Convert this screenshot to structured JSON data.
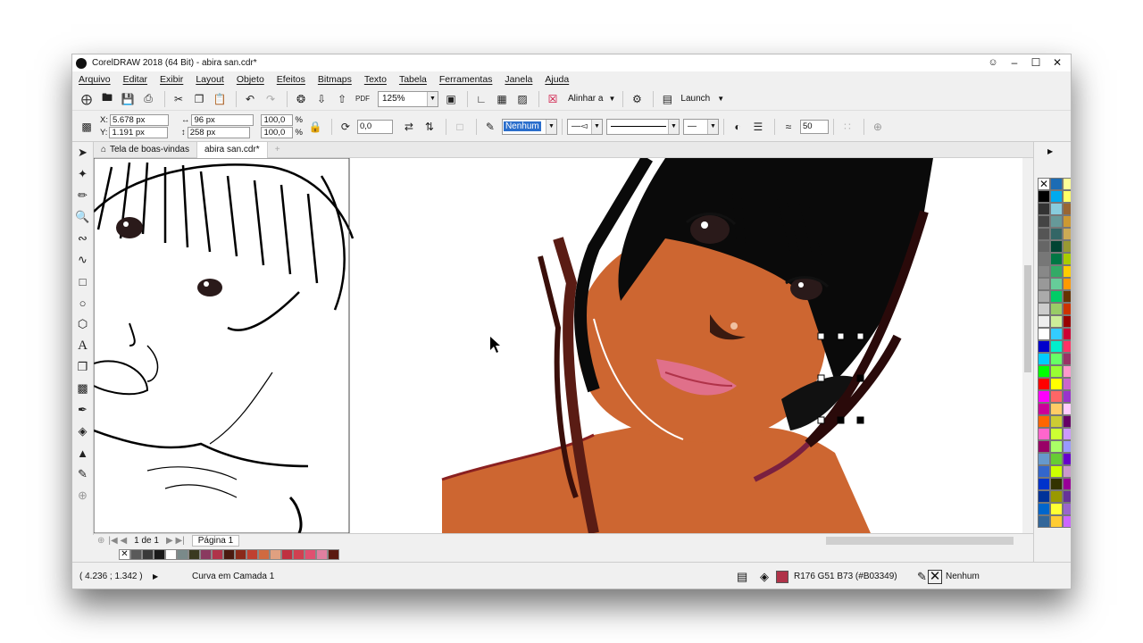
{
  "window": {
    "title": "CorelDRAW 2018 (64 Bit) - abira san.cdr*",
    "controls": [
      "–",
      "☐",
      "✕"
    ]
  },
  "menu": [
    "Arquivo",
    "Editar",
    "Exibir",
    "Layout",
    "Objeto",
    "Efeitos",
    "Bitmaps",
    "Texto",
    "Tabela",
    "Ferramentas",
    "Janela",
    "Ajuda"
  ],
  "toolbar": {
    "zoom": "125%",
    "align_label": "Alinhar a",
    "launch_label": "Launch"
  },
  "properties": {
    "x_label": "X:",
    "x_value": "5.678 px",
    "y_label": "Y:",
    "y_value": "1.191 px",
    "w_value": "96 px",
    "h_value": "258 px",
    "scale_w": "100,0",
    "scale_h": "100,0",
    "pct": "%",
    "rotation": "0,0",
    "outline_value": "Nenhum",
    "smoothing": "50"
  },
  "tabs": {
    "welcome": "Tela de boas-vindas",
    "document": "abira san.cdr*"
  },
  "page_nav": {
    "counter": "1 de 1",
    "page_tab": "Página 1"
  },
  "status": {
    "coords": "( 4.236 ; 1.342 )",
    "object_info": "Curva em Camada 1",
    "fill_info": "R176 G51 B73 (#B03349)",
    "outline_info": "Nenhum",
    "fill_color": "#B03349"
  },
  "colors": {
    "skin": "#CD6631",
    "hair": "#0a0a0a",
    "lips": "#E0708A",
    "strand": "#5a1c14"
  },
  "palette_colors": [
    [
      "#000000",
      "#1c6cb4",
      "#ffff99"
    ],
    [
      "#222222",
      "#00aaee",
      "#ffff66"
    ],
    [
      "#333333",
      "#88ccdd",
      "#996633"
    ],
    [
      "#444444",
      "#669999",
      "#cc9933"
    ],
    [
      "#555555",
      "#336666",
      "#ccaa55"
    ],
    [
      "#666666",
      "#004433",
      "#999933"
    ],
    [
      "#777777",
      "#007744",
      "#aacc00"
    ],
    [
      "#888888",
      "#33aa66",
      "#ffcc00"
    ],
    [
      "#999999",
      "#66cc99",
      "#ff9900"
    ],
    [
      "#aaaaaa",
      "#00cc66",
      "#663300"
    ],
    [
      "#cccccc",
      "#99cc66",
      "#cc3300"
    ],
    [
      "#eeeeee",
      "#ccee99",
      "#990000"
    ],
    [
      "#ffffff",
      "#33ccff",
      "#cc0033"
    ],
    [
      "#0000cc",
      "#00eecc",
      "#ff3366"
    ],
    [
      "#00ccff",
      "#66ff66",
      "#993366"
    ],
    [
      "#00ff00",
      "#99ff33",
      "#ff99cc"
    ],
    [
      "#ff0000",
      "#ffff00",
      "#cc66cc"
    ],
    [
      "#ff00ff",
      "#ff6666",
      "#9933cc"
    ],
    [
      "#cc0099",
      "#ffcc66",
      "#ffccff"
    ],
    [
      "#ff6600",
      "#cccc33",
      "#660066"
    ],
    [
      "#ff66cc",
      "#ccff33",
      "#cc99ff"
    ],
    [
      "#990066",
      "#aaff66",
      "#9999ff"
    ],
    [
      "#6699cc",
      "#66cc33",
      "#6600cc"
    ],
    [
      "#3366cc",
      "#ccff00",
      "#cc99cc"
    ],
    [
      "#0033cc",
      "#333300",
      "#990099"
    ],
    [
      "#003399",
      "#999900",
      "#663399"
    ],
    [
      "#0066cc",
      "#ffff33",
      "#9966cc"
    ],
    [
      "#336699",
      "#ffcc33",
      "#cc66ff"
    ]
  ],
  "doc_palette": [
    "#5a5a5a",
    "#3a3a3a",
    "#1a1a1a",
    "#ffffff",
    "#7a8a8a",
    "#3a3a20",
    "#8a3a60",
    "#b03349",
    "#4a1a10",
    "#8a2a1a",
    "#c04030",
    "#d06a40",
    "#e0a080",
    "#c03040",
    "#d04050",
    "#e05070",
    "#e080a0",
    "#5a1a10"
  ]
}
